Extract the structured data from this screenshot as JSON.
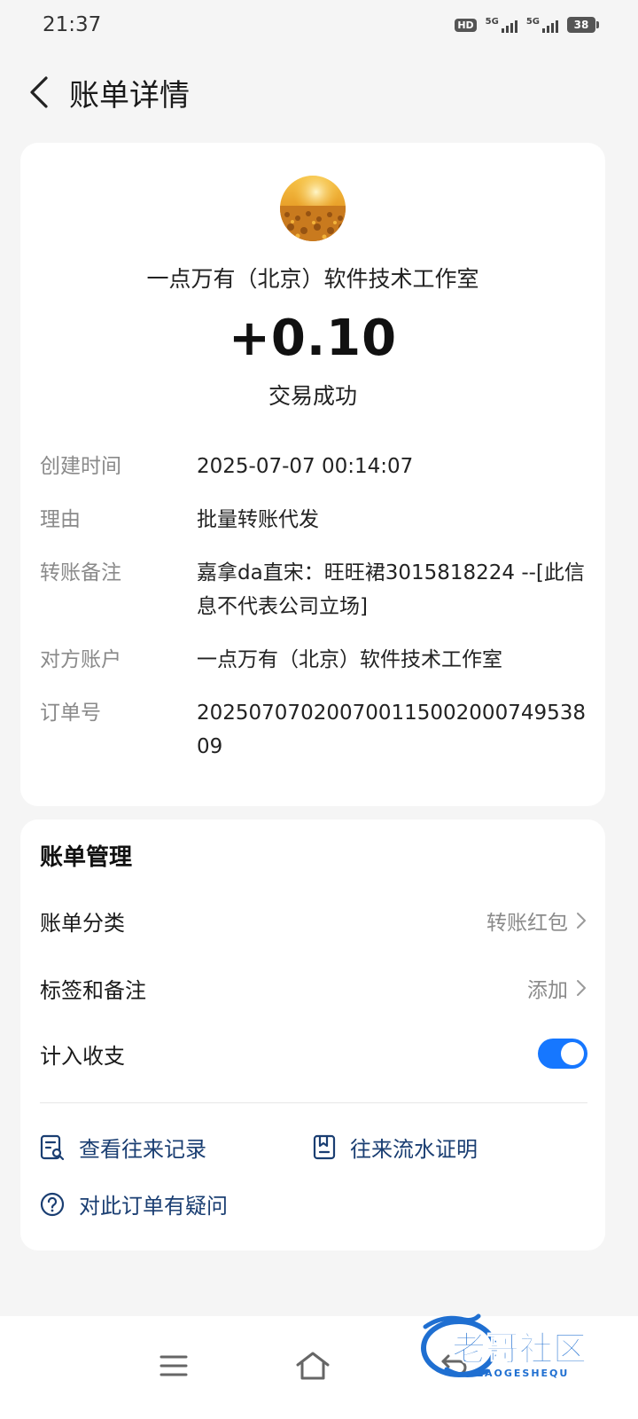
{
  "status_bar": {
    "time": "21:37",
    "hd_badge": "HD",
    "net1": "5G",
    "net2": "5G",
    "battery": "38"
  },
  "header": {
    "title": "账单详情",
    "back_icon": "chevron-left-icon"
  },
  "transaction": {
    "merchant": "一点万有（北京）软件技术工作室",
    "amount": "+0.10",
    "status": "交易成功",
    "details": [
      {
        "label": "创建时间",
        "value": "2025-07-07 00:14:07"
      },
      {
        "label": "理由",
        "value": "批量转账代发"
      },
      {
        "label": "转账备注",
        "value": "嘉拿da直宋：旺旺裙3015818224 --[此信息不代表公司立场]"
      },
      {
        "label": "对方账户",
        "value": "一点万有（北京）软件技术工作室"
      },
      {
        "label": "订单号",
        "value": "20250707020070011500200074953809"
      }
    ]
  },
  "management": {
    "title": "账单管理",
    "category_label": "账单分类",
    "category_value": "转账红包",
    "tags_label": "标签和备注",
    "tags_value": "添加",
    "include_label": "计入收支",
    "include_on": true,
    "links": {
      "records": "查看往来记录",
      "statement": "往来流水证明",
      "question": "对此订单有疑问"
    }
  },
  "watermark": {
    "brand": "老哥社区",
    "brand_latin": "LAOGESHEQU"
  },
  "colors": {
    "accent": "#1677ff",
    "link": "#1a3e72",
    "label_gray": "#8a8a8a",
    "background": "#f5f5f5"
  }
}
